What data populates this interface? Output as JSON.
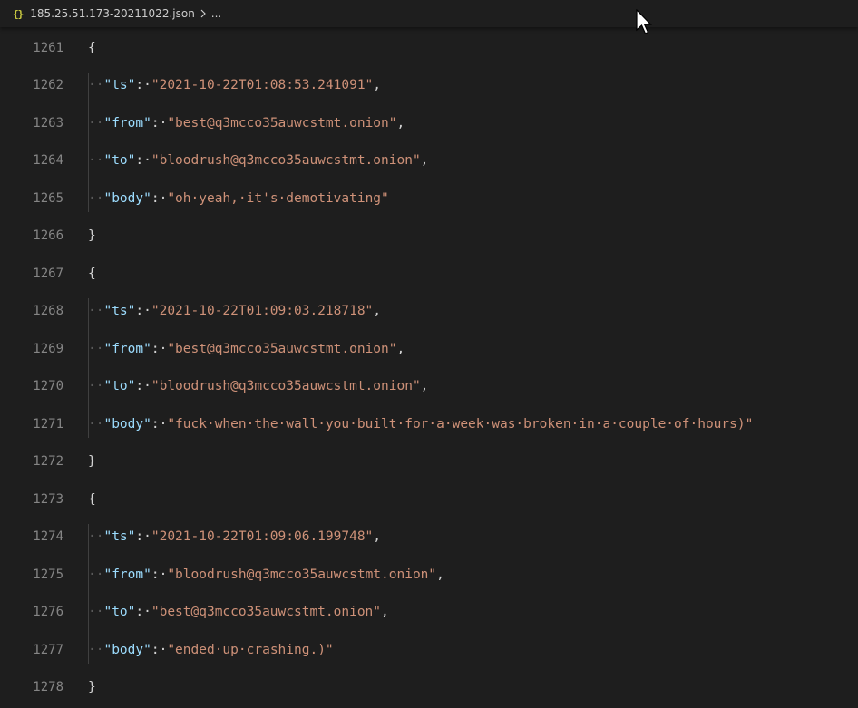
{
  "breadcrumb": {
    "file_icon": "{}",
    "file_name": "185.25.51.173-20211022.json",
    "ellipsis": "..."
  },
  "colors": {
    "background": "#1e1e1e",
    "key": "#9cdcfe",
    "string": "#ce9178",
    "line_number": "#858585",
    "punctuation": "#d4d4d4",
    "file_icon": "#cbcb41"
  },
  "icons": {
    "file": "json-file-icon",
    "separator": "chevron-right-icon",
    "pointer": "mouse-pointer-icon"
  },
  "lines": [
    {
      "number": "1261",
      "indent": "",
      "text": "{"
    },
    {
      "number": "1262",
      "indent": "··",
      "key": "\"ts\"",
      "sep": ":·",
      "value": "\"2021-10-22T01:08:53.241091\"",
      "end": ","
    },
    {
      "number": "1263",
      "indent": "··",
      "key": "\"from\"",
      "sep": ":·",
      "value": "\"best@q3mcco35auwcstmt.onion\"",
      "end": ","
    },
    {
      "number": "1264",
      "indent": "··",
      "key": "\"to\"",
      "sep": ":·",
      "value": "\"bloodrush@q3mcco35auwcstmt.onion\"",
      "end": ","
    },
    {
      "number": "1265",
      "indent": "··",
      "key": "\"body\"",
      "sep": ":·",
      "value": "\"oh·yeah,·it's·demotivating\"",
      "end": ""
    },
    {
      "number": "1266",
      "indent": "",
      "text": "}"
    },
    {
      "number": "1267",
      "indent": "",
      "text": "{"
    },
    {
      "number": "1268",
      "indent": "··",
      "key": "\"ts\"",
      "sep": ":·",
      "value": "\"2021-10-22T01:09:03.218718\"",
      "end": ","
    },
    {
      "number": "1269",
      "indent": "··",
      "key": "\"from\"",
      "sep": ":·",
      "value": "\"best@q3mcco35auwcstmt.onion\"",
      "end": ","
    },
    {
      "number": "1270",
      "indent": "··",
      "key": "\"to\"",
      "sep": ":·",
      "value": "\"bloodrush@q3mcco35auwcstmt.onion\"",
      "end": ","
    },
    {
      "number": "1271",
      "indent": "··",
      "key": "\"body\"",
      "sep": ":·",
      "value": "\"fuck·when·the·wall·you·built·for·a·week·was·broken·in·a·couple·of·hours)\"",
      "end": ""
    },
    {
      "number": "1272",
      "indent": "",
      "text": "}"
    },
    {
      "number": "1273",
      "indent": "",
      "text": "{"
    },
    {
      "number": "1274",
      "indent": "··",
      "key": "\"ts\"",
      "sep": ":·",
      "value": "\"2021-10-22T01:09:06.199748\"",
      "end": ","
    },
    {
      "number": "1275",
      "indent": "··",
      "key": "\"from\"",
      "sep": ":·",
      "value": "\"bloodrush@q3mcco35auwcstmt.onion\"",
      "end": ","
    },
    {
      "number": "1276",
      "indent": "··",
      "key": "\"to\"",
      "sep": ":·",
      "value": "\"best@q3mcco35auwcstmt.onion\"",
      "end": ","
    },
    {
      "number": "1277",
      "indent": "··",
      "key": "\"body\"",
      "sep": ":·",
      "value": "\"ended·up·crashing.)\"",
      "end": ""
    },
    {
      "number": "1278",
      "indent": "",
      "text": "}"
    }
  ]
}
